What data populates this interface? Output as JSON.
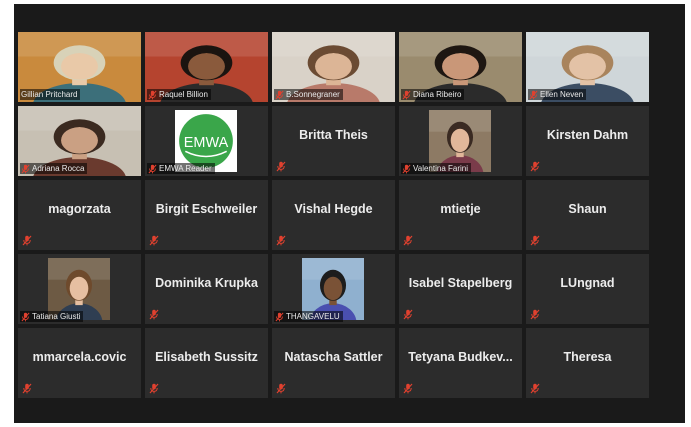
{
  "grid": {
    "tiles": [
      {
        "name": "Gillian Pritchard",
        "kind": "video",
        "muted": false,
        "active": true,
        "bg": "#c98a3d",
        "skin": "#e9c9a8",
        "hair": "#d8d2b8",
        "shirt": "#3c6f7a"
      },
      {
        "name": "Raquel Billion",
        "kind": "video",
        "muted": true,
        "bg": "#b5442f",
        "skin": "#8a5a3c",
        "hair": "#1b1410",
        "shirt": "#2a2a2a"
      },
      {
        "name": "B.Sonnegraner",
        "kind": "video",
        "muted": true,
        "bg": "#d9d2c8",
        "skin": "#dcb596",
        "hair": "#6b4b33",
        "shirt": "#b87a6a"
      },
      {
        "name": "Diana Ribeiro",
        "kind": "video",
        "muted": true,
        "bg": "#9a8b6e",
        "skin": "#c99778",
        "hair": "#1e1712",
        "shirt": "#2b2b2b"
      },
      {
        "name": "Ellen Neven",
        "kind": "video",
        "muted": true,
        "bg": "#cfd6d9",
        "skin": "#e3c2a6",
        "hair": "#a9845d",
        "shirt": "#3b4d63"
      },
      {
        "name": "Adriana Rocca",
        "kind": "video",
        "muted": true,
        "bg": "#c7c0b3",
        "skin": "#caa083",
        "hair": "#3b2a20",
        "shirt": "#6a3a2e"
      },
      {
        "name": "EMWA Reader",
        "kind": "logo",
        "muted": true,
        "logo_text": "EMWA"
      },
      {
        "name": "Britta Theis",
        "kind": "name",
        "muted": true
      },
      {
        "name": "Valentina Farini",
        "kind": "video-mid",
        "muted": true,
        "bg": "#8d7a64",
        "skin": "#e1b79a",
        "hair": "#3a2a22",
        "shirt": "#7a3b4a"
      },
      {
        "name": "Kirsten Dahm",
        "kind": "name",
        "muted": true
      },
      {
        "name": "magorzata",
        "kind": "name",
        "muted": true
      },
      {
        "name": "Birgit Eschweiler",
        "kind": "name",
        "muted": true
      },
      {
        "name": "Vishal Hegde",
        "kind": "name",
        "muted": true
      },
      {
        "name": "mtietje",
        "kind": "name",
        "muted": true
      },
      {
        "name": "Shaun",
        "kind": "name",
        "muted": true
      },
      {
        "name": "Tatiana Giusti",
        "kind": "video-mid",
        "muted": true,
        "bg": "#6d5a44",
        "skin": "#e6bfa1",
        "hair": "#6e4a2c",
        "shirt": "#2f3e52"
      },
      {
        "name": "Dominika Krupka",
        "kind": "name",
        "muted": true
      },
      {
        "name": "THANGAVELU",
        "kind": "video-mid",
        "muted": true,
        "bg": "#8fb0cf",
        "skin": "#7a5236",
        "hair": "#1d1d1d",
        "shirt": "#4a4fb0"
      },
      {
        "name": "Isabel Stapelberg",
        "kind": "name",
        "muted": true
      },
      {
        "name": "LUngnad",
        "kind": "name",
        "muted": true
      },
      {
        "name": "mmarcela.covic",
        "kind": "name",
        "muted": true
      },
      {
        "name": "Elisabeth Sussitz",
        "kind": "name",
        "muted": true
      },
      {
        "name": "Natascha Sattler",
        "kind": "name",
        "muted": true
      },
      {
        "name": "Tetyana  Budkev...",
        "kind": "name",
        "muted": true
      },
      {
        "name": "Theresa",
        "kind": "name",
        "muted": true
      }
    ]
  },
  "colors": {
    "muted_icon": "#e0412f",
    "tile_bg": "#2c2c2c",
    "frame_bg": "#1a1a1a",
    "active_border": "#e6e04a",
    "logo_green": "#3aa64a"
  }
}
